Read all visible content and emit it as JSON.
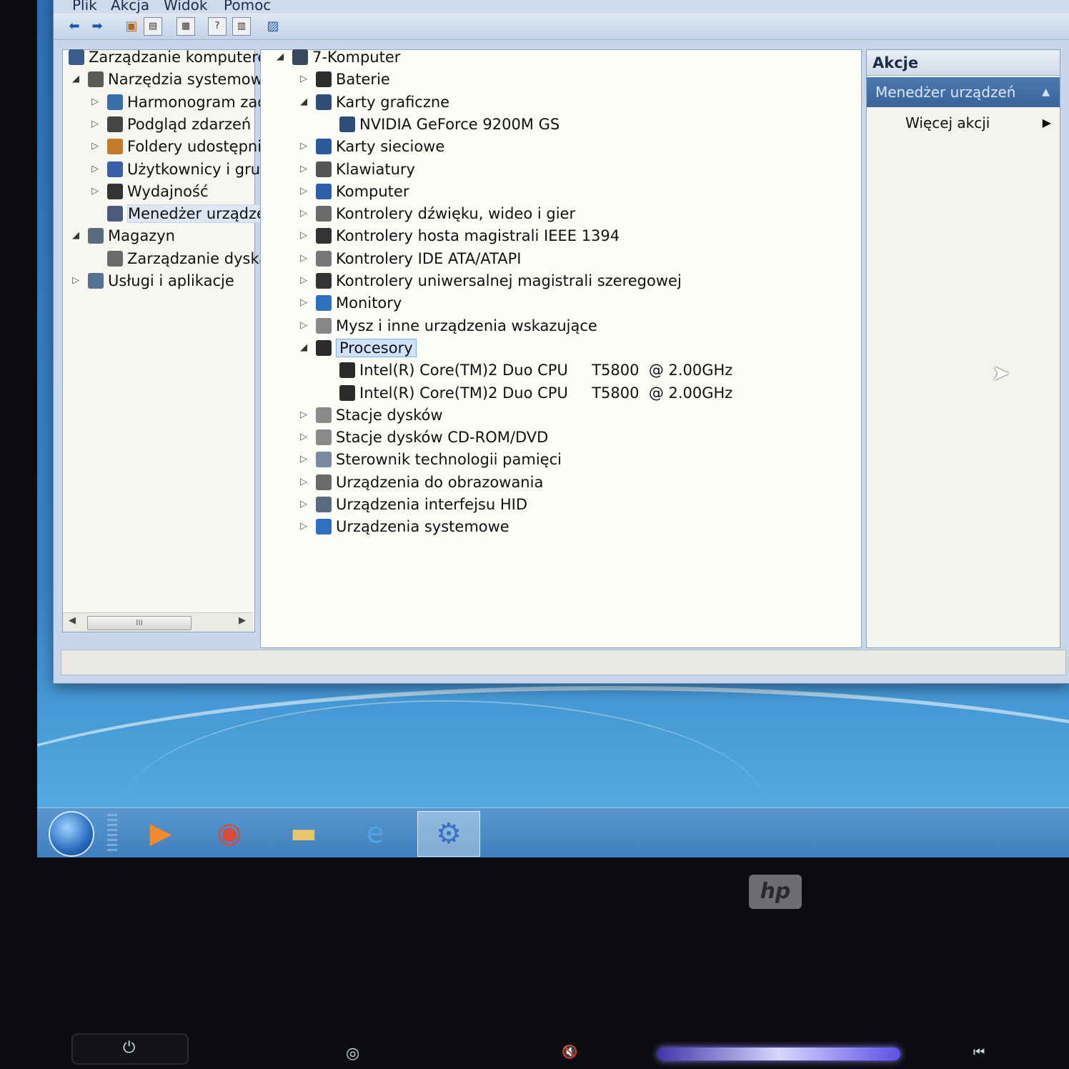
{
  "menu": [
    "Plik",
    "Akcja",
    "Widok",
    "Pomoc"
  ],
  "left_tree": [
    {
      "label": "Zarządzanie komputerer",
      "level": 0,
      "expander": "",
      "icon": "computer-management-icon",
      "color": "#3b5b8a"
    },
    {
      "label": "Narzędzia systemowe",
      "level": 1,
      "expander": "open",
      "icon": "tools-icon",
      "color": "#5a5a5a"
    },
    {
      "label": "Harmonogram zad",
      "level": 2,
      "expander": "closed",
      "icon": "clock-icon",
      "color": "#3a6ea8"
    },
    {
      "label": "Podgląd zdarzeń",
      "level": 2,
      "expander": "closed",
      "icon": "event-viewer-icon",
      "color": "#444444"
    },
    {
      "label": "Foldery udostępnic",
      "level": 2,
      "expander": "closed",
      "icon": "shared-folder-icon",
      "color": "#c47a2c"
    },
    {
      "label": "Użytkownicy i grup",
      "level": 2,
      "expander": "closed",
      "icon": "users-icon",
      "color": "#3b5fa8"
    },
    {
      "label": "Wydajność",
      "level": 2,
      "expander": "closed",
      "icon": "performance-icon",
      "color": "#333333"
    },
    {
      "label": "Menedżer urządze",
      "level": 2,
      "expander": "",
      "icon": "device-manager-icon",
      "color": "#4a5a7a",
      "selected": true
    },
    {
      "label": "Magazyn",
      "level": 1,
      "expander": "open",
      "icon": "storage-icon",
      "color": "#5b6b80"
    },
    {
      "label": "Zarządzanie dyska",
      "level": 2,
      "expander": "",
      "icon": "disk-management-icon",
      "color": "#6a6a6a"
    },
    {
      "label": "Usługi i aplikacje",
      "level": 1,
      "expander": "closed",
      "icon": "services-icon",
      "color": "#56718f"
    }
  ],
  "scrollbar": {
    "thumb": "III"
  },
  "device_tree": [
    {
      "label": "7-Komputer",
      "level": 0,
      "expander": "open",
      "icon": "computer-icon",
      "color": "#3a4a5e"
    },
    {
      "label": "Baterie",
      "level": 1,
      "expander": "closed",
      "icon": "battery-icon",
      "color": "#2d2d2d"
    },
    {
      "label": "Karty graficzne",
      "level": 1,
      "expander": "open",
      "icon": "display-adapter-icon",
      "color": "#2f4f7a"
    },
    {
      "label": "NVIDIA GeForce 9200M GS",
      "level": 2,
      "expander": "",
      "icon": "display-adapter-icon",
      "color": "#2f4f7a"
    },
    {
      "label": "Karty sieciowe",
      "level": 1,
      "expander": "closed",
      "icon": "network-adapter-icon",
      "color": "#2d5a9a"
    },
    {
      "label": "Klawiatury",
      "level": 1,
      "expander": "closed",
      "icon": "keyboard-icon",
      "color": "#555555"
    },
    {
      "label": "Komputer",
      "level": 1,
      "expander": "closed",
      "icon": "computer-icon",
      "color": "#2f5ea8"
    },
    {
      "label": "Kontrolery dźwięku, wideo i gier",
      "level": 1,
      "expander": "closed",
      "icon": "speaker-icon",
      "color": "#6a6a6a"
    },
    {
      "label": "Kontrolery hosta magistrali IEEE 1394",
      "level": 1,
      "expander": "closed",
      "icon": "firewire-icon",
      "color": "#333333"
    },
    {
      "label": "Kontrolery IDE ATA/ATAPI",
      "level": 1,
      "expander": "closed",
      "icon": "ide-controller-icon",
      "color": "#777777"
    },
    {
      "label": "Kontrolery uniwersalnej magistrali szeregowej",
      "level": 1,
      "expander": "closed",
      "icon": "usb-icon",
      "color": "#333333"
    },
    {
      "label": "Monitory",
      "level": 1,
      "expander": "closed",
      "icon": "monitor-icon",
      "color": "#2f6fc0"
    },
    {
      "label": "Mysz i inne urządzenia wskazujące",
      "level": 1,
      "expander": "closed",
      "icon": "mouse-icon",
      "color": "#888888"
    },
    {
      "label": "Procesory",
      "level": 1,
      "expander": "open",
      "icon": "processor-icon",
      "color": "#2a2a2a",
      "selected": true
    },
    {
      "label": "Intel(R) Core(TM)2 Duo CPU     T5800  @ 2.00GHz",
      "level": 2,
      "expander": "",
      "icon": "processor-icon",
      "color": "#2a2a2a"
    },
    {
      "label": "Intel(R) Core(TM)2 Duo CPU     T5800  @ 2.00GHz",
      "level": 2,
      "expander": "",
      "icon": "processor-icon",
      "color": "#2a2a2a"
    },
    {
      "label": "Stacje dysków",
      "level": 1,
      "expander": "closed",
      "icon": "disk-drive-icon",
      "color": "#8a8a8a"
    },
    {
      "label": "Stacje dysków CD-ROM/DVD",
      "level": 1,
      "expander": "closed",
      "icon": "cdrom-icon",
      "color": "#8a8a8a"
    },
    {
      "label": "Sterownik technologii pamięci",
      "level": 1,
      "expander": "closed",
      "icon": "memory-controller-icon",
      "color": "#7a8aa0"
    },
    {
      "label": "Urządzenia do obrazowania",
      "level": 1,
      "expander": "closed",
      "icon": "camera-icon",
      "color": "#6a6a6a"
    },
    {
      "label": "Urządzenia interfejsu HID",
      "level": 1,
      "expander": "closed",
      "icon": "hid-icon",
      "color": "#5a6a80"
    },
    {
      "label": "Urządzenia systemowe",
      "level": 1,
      "expander": "closed",
      "icon": "system-devices-icon",
      "color": "#2f6fc0"
    }
  ],
  "actions": {
    "header": "Akcje",
    "section": "Menedżer urządzeń",
    "more": "Więcej akcji"
  },
  "taskbar": {
    "items": [
      {
        "icon": "media-player-icon",
        "glyph": "▶",
        "color": "#f28a2e"
      },
      {
        "icon": "chrome-icon",
        "glyph": "◉",
        "color": "#d94a3a"
      },
      {
        "icon": "folder-icon",
        "glyph": "▬",
        "color": "#e7c56a"
      },
      {
        "icon": "internet-explorer-icon",
        "glyph": "e",
        "color": "#4da3e6"
      },
      {
        "icon": "computer-management-icon",
        "glyph": "⚙",
        "color": "#3b6fc4",
        "active": true
      }
    ]
  },
  "bezel": {
    "logo": "hp"
  }
}
